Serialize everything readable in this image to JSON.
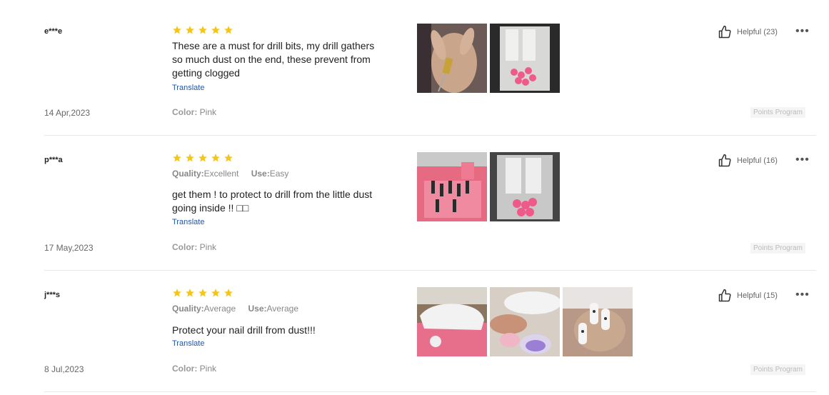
{
  "reviews": [
    {
      "user": "e***e",
      "rating": 5,
      "attributes": [],
      "text": "These are a must for drill bits, my drill gathers so much dust on the end, these prevent from getting clogged",
      "translate": "Translate",
      "date": "14 Apr,2023",
      "color_label": "Color:",
      "color_value": "Pink",
      "helpful": "Helpful (23)",
      "badge": "Points Program"
    },
    {
      "user": "p***a",
      "rating": 5,
      "attributes": [
        {
          "label": "Quality:",
          "value": "Excellent"
        },
        {
          "label": "Use:",
          "value": "Easy"
        }
      ],
      "text": "get them ! to protect to drill from the little dust going inside !! □□",
      "translate": "Translate",
      "date": "17 May,2023",
      "color_label": "Color:",
      "color_value": "Pink",
      "helpful": "Helpful (16)",
      "badge": "Points Program"
    },
    {
      "user": "j***s",
      "rating": 5,
      "attributes": [
        {
          "label": "Quality:",
          "value": "Average"
        },
        {
          "label": "Use:",
          "value": "Average"
        }
      ],
      "text": "Protect your nail drill from dust!!!",
      "translate": "Translate",
      "date": "8 Jul,2023",
      "color_label": "Color:",
      "color_value": "Pink",
      "helpful": "Helpful (15)",
      "badge": "Points Program"
    }
  ],
  "colors": {
    "star": "#f5c518",
    "translate_link": "#2255aa",
    "divider": "#e8e8e8"
  },
  "icons": {
    "star": "star-icon",
    "thumb": "thumbs-up-icon",
    "more": "more-options-icon"
  }
}
